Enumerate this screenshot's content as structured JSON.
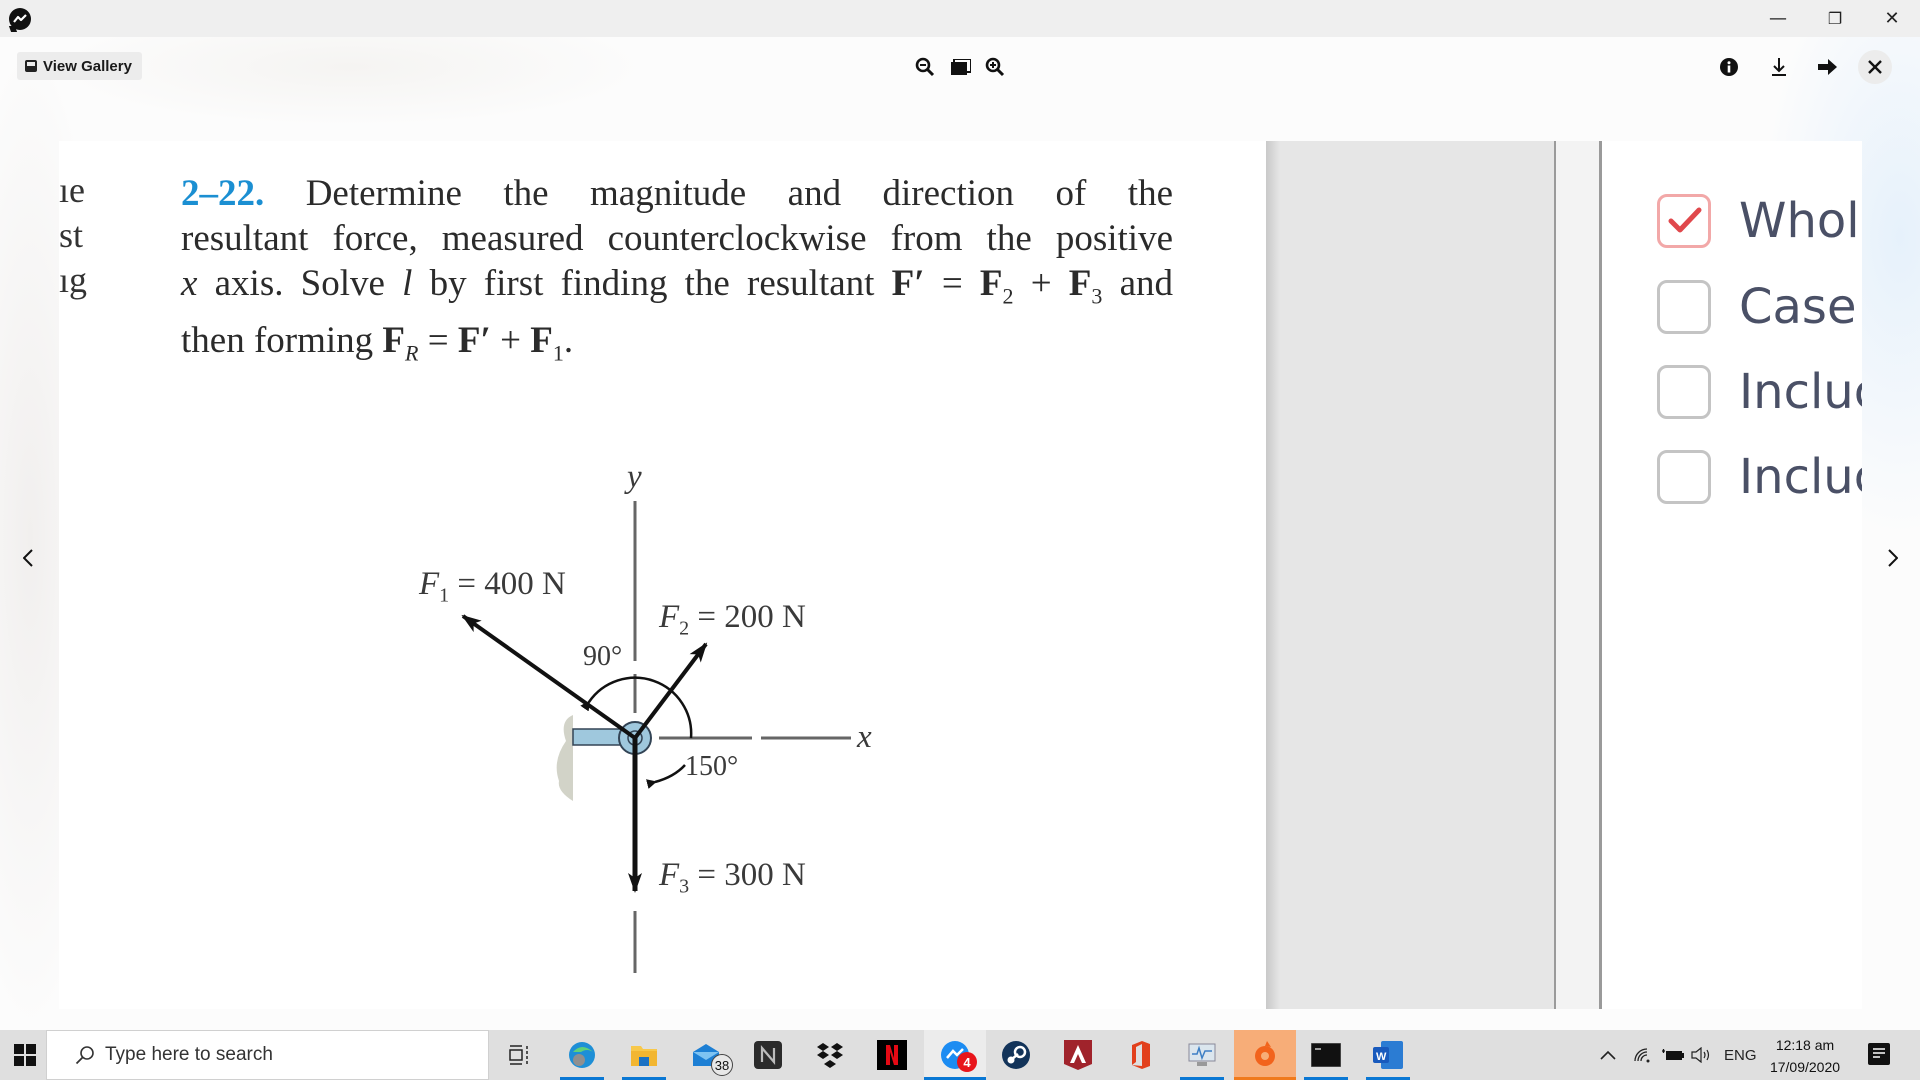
{
  "window": {
    "app_icon": "messenger-icon",
    "controls": {
      "minimize": "—",
      "restore": "❐",
      "close": "✕"
    }
  },
  "viewer": {
    "gallery_button": "View Gallery",
    "toolbar": {
      "zoom_out": "zoom-out-icon",
      "fit": "fit-screen-icon",
      "zoom_in": "zoom-in-icon",
      "info": "info-icon",
      "download": "download-icon",
      "forward": "forward-arrow-icon",
      "close": "close-icon"
    },
    "prev": "‹",
    "next": "›"
  },
  "photo": {
    "margin_fragments": [
      "ıe",
      "st",
      "ıg"
    ],
    "problem": {
      "number": "2–22.",
      "lines": [
        " Determine the magnitude and direction of the",
        "resultant force, measured counterclockwise from the positive",
        "x axis. Solve l by first finding the resultant F′ = F₂ + F₃ and",
        "then forming F_R = F′ + F₁."
      ],
      "line3_parts": {
        "x": "x",
        "rest1": " axis. Solve ",
        "l": "l",
        "rest2": " by first finding the resultant ",
        "Fp": "F′",
        "eq": " = ",
        "F": "F",
        "sub2": "2",
        "plus": " + ",
        "F3": "F",
        "sub3": "3",
        "and": " and"
      },
      "line4_parts": {
        "pre": "then forming ",
        "F": "F",
        "R": "R",
        "eq": " = ",
        "Fp": "F′",
        "plus": " + ",
        "F1": "F",
        "sub1": "1",
        "dot": "."
      }
    },
    "diagram": {
      "y_axis": "y",
      "x_axis": "x",
      "forces": [
        {
          "name": "F",
          "sub": "1",
          "label": " = 400 N",
          "magnitude_N": 400
        },
        {
          "name": "F",
          "sub": "2",
          "label": " = 200 N",
          "magnitude_N": 200
        },
        {
          "name": "F",
          "sub": "3",
          "label": " = 300 N",
          "magnitude_N": 300
        }
      ],
      "angles": [
        "90°",
        "150°"
      ]
    },
    "checkboxes": [
      {
        "label": "Whole",
        "checked": true
      },
      {
        "label": "Case S",
        "checked": false
      },
      {
        "label": "Incluc",
        "checked": false
      },
      {
        "label": "Incluc",
        "checked": false
      }
    ]
  },
  "taskbar": {
    "search_placeholder": "Type here to search",
    "mail_badge": "38",
    "messenger_badge": "4",
    "apps": [
      "task-view",
      "edge",
      "file-explorer",
      "mail",
      "notion",
      "dropbox",
      "netflix",
      "messenger",
      "steam",
      "apex-legends",
      "office",
      "performance-monitor",
      "origin",
      "terminal",
      "word"
    ],
    "tray": {
      "language": "ENG",
      "time": "12:18 am",
      "date": "17/09/2020"
    }
  }
}
